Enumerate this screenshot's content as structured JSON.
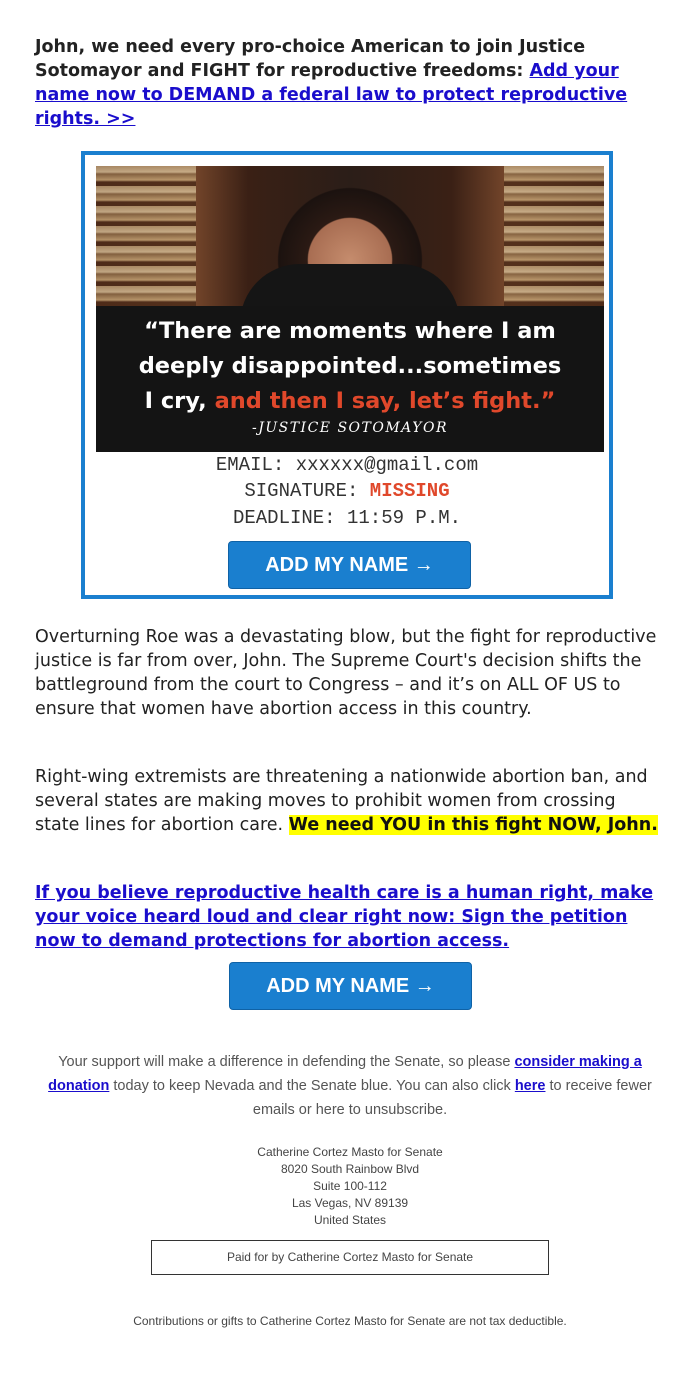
{
  "intro": {
    "text": "John, we need every pro-choice American to join Justice Sotomayor and FIGHT for reproductive freedoms: ",
    "link": "Add your name now to DEMAND a federal law to protect reproductive rights. >>"
  },
  "image": {
    "quote_line1": "“There are moments where I am",
    "quote_line2": "deeply disappointed...sometimes",
    "quote_line3_white": "I cry, ",
    "quote_line3_red": "and then I say, let’s fight.”",
    "attribution": "-JUSTICE SOTOMAYOR"
  },
  "petition": {
    "email_label": "EMAIL:",
    "email_value": "xxxxxx@gmail.com",
    "signature_label": "SIGNATURE:",
    "signature_value": "MISSING",
    "deadline_label": "DEADLINE:",
    "deadline_value": "11:59 P.M."
  },
  "buttons": {
    "add_name_1": "ADD MY NAME →",
    "add_name_2": "ADD MY NAME →"
  },
  "body": {
    "para1": "Overturning Roe was a devastating blow, but the fight for reproductive justice is far from over, John. The Supreme Court's decision shifts the battleground from the court to Congress – and it’s on ALL OF US to ensure that women have abortion access in this country.",
    "para2_text": "Right-wing extremists are threatening a nationwide abortion ban, and several states are making moves to prohibit women from crossing state lines for abortion care. ",
    "para2_highlight": "We need YOU in this fight NOW, John.",
    "cta_link": "If you believe reproductive health care is a human right, make your voice heard loud and clear right now: Sign the petition now to demand protections for abortion access."
  },
  "footer": {
    "support_pre": "Your support will make a difference in defending the Senate, so please ",
    "donation_link": "consider making a donation",
    "support_mid": " today to keep Nevada and the Senate blue. You can also click ",
    "here_link": "here",
    "support_post": " to receive fewer emails or here to unsubscribe.",
    "address": [
      "Catherine Cortez Masto for Senate",
      "8020 South Rainbow Blvd",
      "Suite 100-112",
      "Las Vegas, NV 89139",
      "United States"
    ],
    "paid_for": "Paid for by Catherine Cortez Masto for Senate",
    "disclaimer": "Contributions or gifts to Catherine Cortez Masto for Senate are not tax deductible."
  },
  "colors": {
    "accent_blue": "#1a7fcf",
    "link_blue": "#1a0dcc",
    "alert_red": "#e0482b",
    "highlight": "#ffff00"
  }
}
